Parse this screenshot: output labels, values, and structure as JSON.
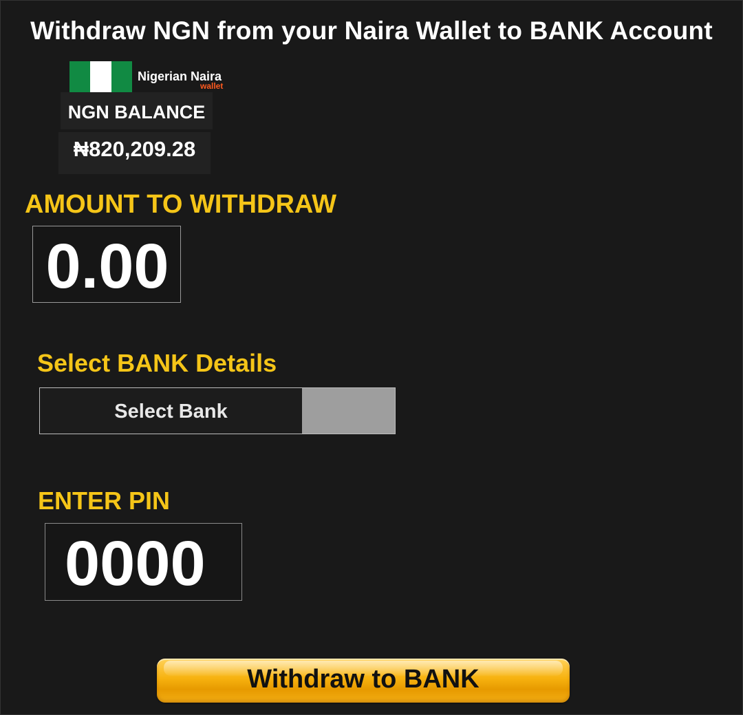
{
  "page": {
    "title": "Withdraw NGN from your Naira Wallet to BANK Account"
  },
  "wallet": {
    "name": "Nigerian Naira",
    "sub_label": "wallet",
    "balance_label": "NGN BALANCE",
    "balance_value": "₦820,209.28",
    "flag_icon": "nigeria-flag-icon"
  },
  "amount": {
    "label": "AMOUNT TO WITHDRAW",
    "value": "0.00"
  },
  "bank": {
    "label": "Select BANK Details",
    "selected": "Select Bank"
  },
  "pin": {
    "label": "ENTER PIN",
    "value": "0000"
  },
  "actions": {
    "withdraw_label": "Withdraw to BANK"
  },
  "colors": {
    "background": "#191919",
    "accent_yellow": "#f5c518",
    "flag_green": "#118a43",
    "wallet_orange": "#ff5a1f",
    "button_gold": "#f7b20f"
  }
}
